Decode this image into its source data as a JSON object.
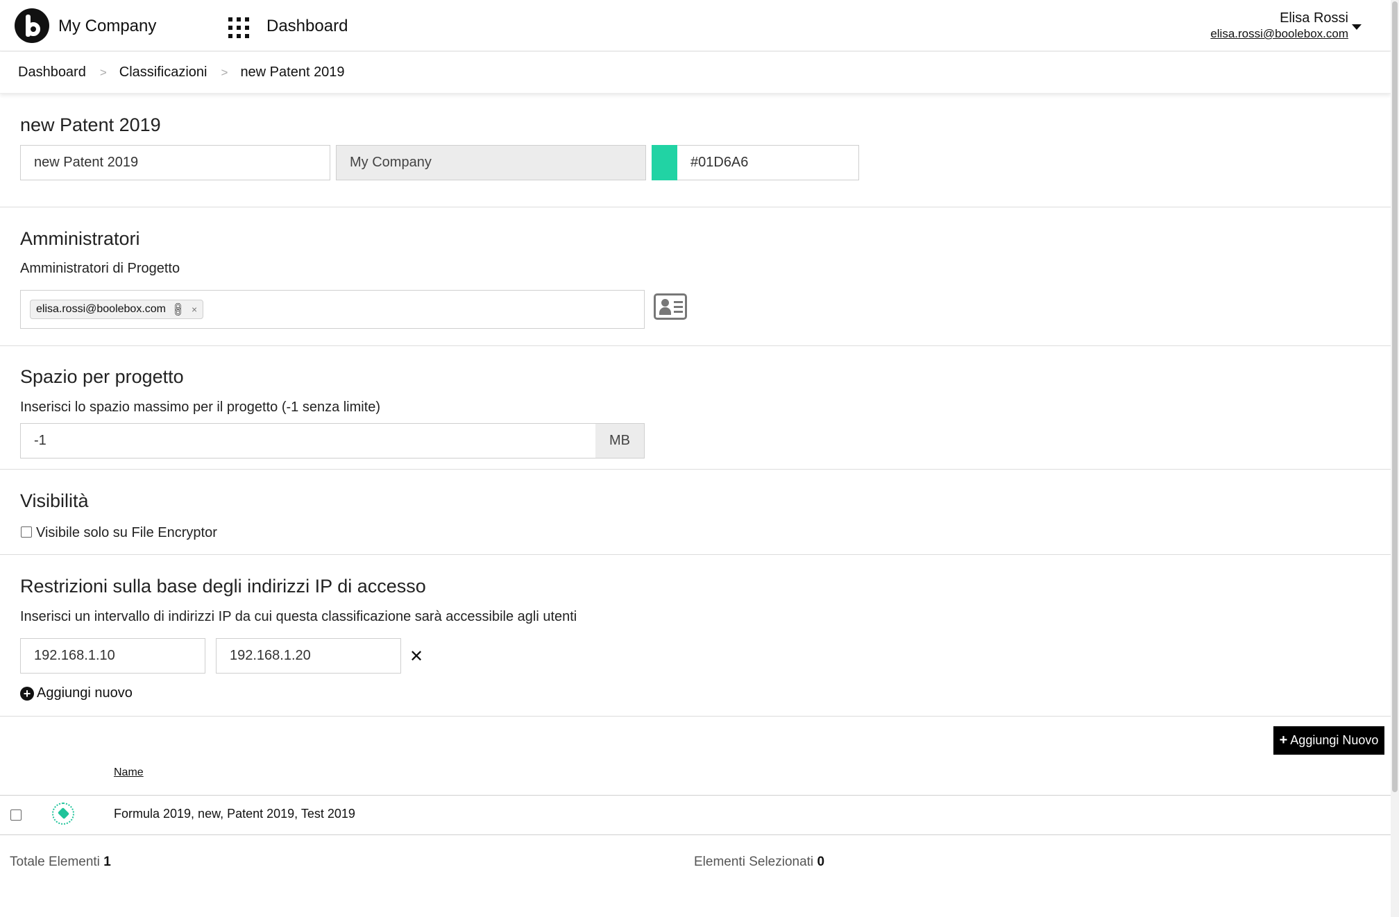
{
  "header": {
    "company": "My Company",
    "app_title": "Dashboard",
    "user_name": "Elisa Rossi",
    "user_email": "elisa.rossi@boolebox.com"
  },
  "breadcrumb": [
    "Dashboard",
    "Classificazioni",
    "new Patent 2019"
  ],
  "breadcrumb_separator": ">",
  "general": {
    "title": "new Patent 2019",
    "name_value": "new Patent 2019",
    "company_value": "My Company",
    "color_value": "#01D6A6",
    "swatch_color": "#21d3a4"
  },
  "admins": {
    "title": "Amministratori",
    "label": "Amministratori di Progetto",
    "tags": [
      "elisa.rossi@boolebox.com"
    ],
    "tag_remove": "×"
  },
  "space": {
    "title": "Spazio per progetto",
    "label": "Inserisci lo spazio massimo per il progetto (-1 senza limite)",
    "value": "-1",
    "unit": "MB"
  },
  "visibility": {
    "title": "Visibilità",
    "checkbox_label": "Visibile solo su File Encryptor",
    "checked": false
  },
  "ip": {
    "title": "Restrizioni sulla base degli indirizzi IP di accesso",
    "label": "Inserisci un intervallo di indirizzi IP da cui questa classificazione sarà accessibile agli utenti",
    "range_start": "192.168.1.10",
    "range_end": "192.168.1.20",
    "remove": "✕",
    "add_label": "Aggiungi nuovo"
  },
  "list": {
    "add_button": "Aggiungi Nuovo",
    "column_name": "Name",
    "rows": [
      {
        "name": "Formula 2019, new, Patent 2019, Test 2019"
      }
    ],
    "total_label": "Totale Elementi",
    "total_value": "1",
    "selected_label": "Elementi Selezionati",
    "selected_value": "0"
  },
  "icons": {
    "logo": "boolebox-logo",
    "apps": "apps-grid-icon",
    "caret": "caret-down-icon",
    "link": "link-icon",
    "contact": "contact-card-icon",
    "remove": "close-icon",
    "add": "plus-circle-icon",
    "tag": "tag-icon"
  }
}
